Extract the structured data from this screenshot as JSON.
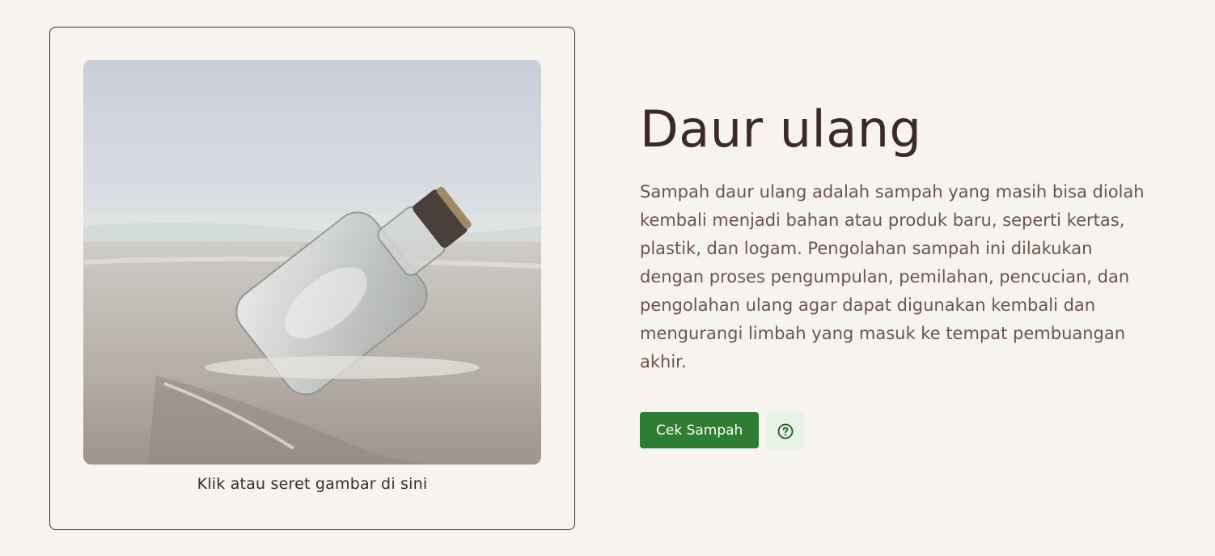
{
  "upload": {
    "image_description": "glass bottle on a beach",
    "hint": "Klik atau seret gambar di sini"
  },
  "info": {
    "title": "Daur ulang",
    "description": "Sampah daur ulang adalah sampah yang masih bisa diolah kembali menjadi bahan atau produk baru, seperti kertas, plastik, dan logam. Pengolahan sampah ini dilakukan dengan proses pengumpulan, pemilahan, pencucian, dan pengolahan ulang agar dapat digunakan kembali dan mengurangi limbah yang masuk ke tempat pembuangan akhir."
  },
  "actions": {
    "check_label": "Cek Sampah",
    "help_icon": "question-circle-icon"
  },
  "colors": {
    "background": "#f7f4f0",
    "text_dark": "#3b2a27",
    "text_body": "#6b534e",
    "primary_green": "#2e7d32",
    "help_bg": "#e6f3e6"
  }
}
